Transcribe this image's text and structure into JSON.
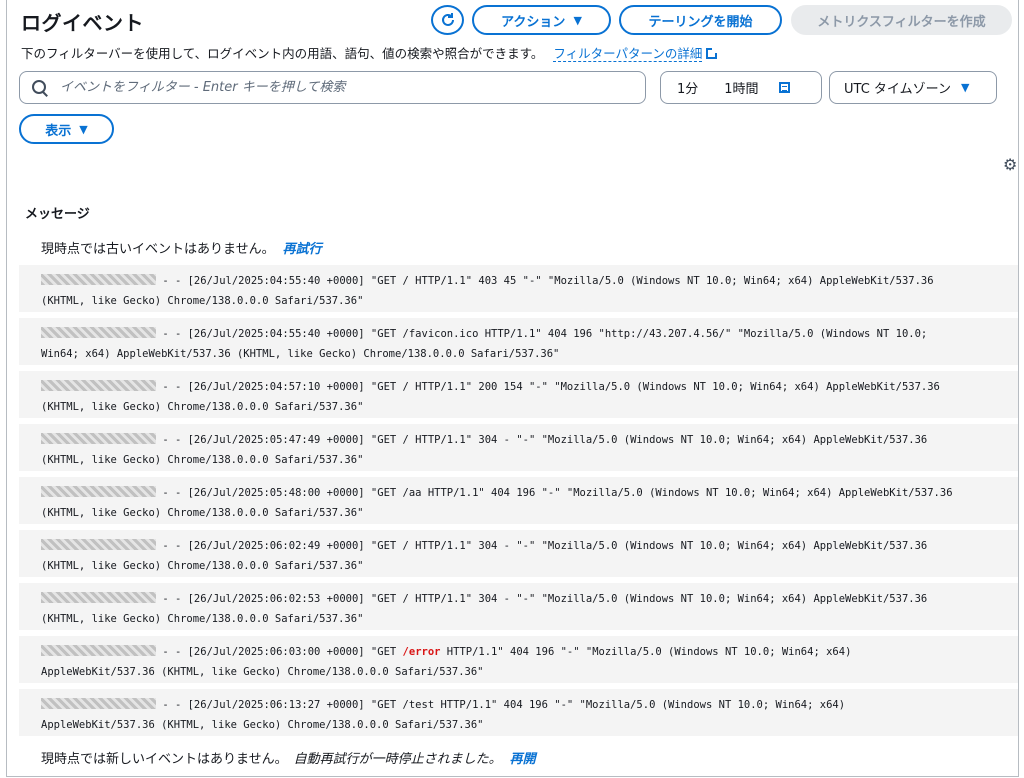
{
  "header": {
    "title": "ログイベント",
    "actions_label": "アクション",
    "tail_label": "テーリングを開始",
    "metric_filter_label": "メトリクスフィルターを作成",
    "description": "下のフィルターバーを使用して、ログイベント内の用語、語句、値の検索や照合ができます。",
    "filter_pattern_link": "フィルターパターンの詳細"
  },
  "search": {
    "placeholder": "イベントをフィルター - Enter キーを押して検索"
  },
  "time_range": {
    "option_1": "1分",
    "option_2": "1時間"
  },
  "timezone": {
    "label": "UTC タイムゾーン"
  },
  "view": {
    "label": "表示"
  },
  "table": {
    "column_message": "メッセージ"
  },
  "notices": {
    "older_text": "現時点では古いイベントはありません。",
    "older_link": "再試行",
    "newer_text": "現時点では新しいイベントはありません。",
    "newer_paused": "自動再試行が一時停止されました。",
    "newer_link": "再開"
  },
  "logs": [
    {
      "line1": " - - [26/Jul/2025:04:55:40 +0000] \"GET / HTTP/1.1\" 403 45 \"-\" \"Mozilla/5.0 (Windows NT 10.0; Win64; x64) AppleWebKit/537.36",
      "line2": "(KHTML, like Gecko) Chrome/138.0.0.0 Safari/537.36\""
    },
    {
      "line1": " - - [26/Jul/2025:04:55:40 +0000] \"GET /favicon.ico HTTP/1.1\" 404 196 \"http://43.207.4.56/\" \"Mozilla/5.0 (Windows NT 10.0;",
      "line2": "Win64; x64) AppleWebKit/537.36 (KHTML, like Gecko) Chrome/138.0.0.0 Safari/537.36\""
    },
    {
      "line1": " - - [26/Jul/2025:04:57:10 +0000] \"GET / HTTP/1.1\" 200 154 \"-\" \"Mozilla/5.0 (Windows NT 10.0; Win64; x64) AppleWebKit/537.36",
      "line2": "(KHTML, like Gecko) Chrome/138.0.0.0 Safari/537.36\""
    },
    {
      "line1": " - - [26/Jul/2025:05:47:49 +0000] \"GET / HTTP/1.1\" 304 - \"-\" \"Mozilla/5.0 (Windows NT 10.0; Win64; x64) AppleWebKit/537.36",
      "line2": "(KHTML, like Gecko) Chrome/138.0.0.0 Safari/537.36\""
    },
    {
      "line1": " - - [26/Jul/2025:05:48:00 +0000] \"GET /aa HTTP/1.1\" 404 196 \"-\" \"Mozilla/5.0 (Windows NT 10.0; Win64; x64) AppleWebKit/537.36",
      "line2": "(KHTML, like Gecko) Chrome/138.0.0.0 Safari/537.36\""
    },
    {
      "line1": " - - [26/Jul/2025:06:02:49 +0000] \"GET / HTTP/1.1\" 304 - \"-\" \"Mozilla/5.0 (Windows NT 10.0; Win64; x64) AppleWebKit/537.36",
      "line2": "(KHTML, like Gecko) Chrome/138.0.0.0 Safari/537.36\""
    },
    {
      "line1": " - - [26/Jul/2025:06:02:53 +0000] \"GET / HTTP/1.1\" 304 - \"-\" \"Mozilla/5.0 (Windows NT 10.0; Win64; x64) AppleWebKit/537.36",
      "line2": "(KHTML, like Gecko) Chrome/138.0.0.0 Safari/537.36\""
    },
    {
      "line1a": " - - [26/Jul/2025:06:03:00 +0000] \"GET ",
      "line1_hl": "/error",
      "line1b": " HTTP/1.1\" 404 196 \"-\" \"Mozilla/5.0 (Windows NT 10.0; Win64; x64)",
      "line2": "AppleWebKit/537.36 (KHTML, like Gecko) Chrome/138.0.0.0 Safari/537.36\""
    },
    {
      "line1": " - - [26/Jul/2025:06:13:27 +0000] \"GET /test HTTP/1.1\" 404 196 \"-\" \"Mozilla/5.0 (Windows NT 10.0; Win64; x64)",
      "line2": "AppleWebKit/537.36 (KHTML, like Gecko) Chrome/138.0.0.0 Safari/537.36\""
    }
  ],
  "colors": {
    "accent": "#0972d3",
    "highlight": "#d91515",
    "row_bg": "#f4f4f4"
  },
  "icons": {
    "refresh": "refresh-icon",
    "search": "search-icon",
    "calendar": "calendar-icon",
    "settings": "gear-icon",
    "external": "external-link-icon"
  }
}
